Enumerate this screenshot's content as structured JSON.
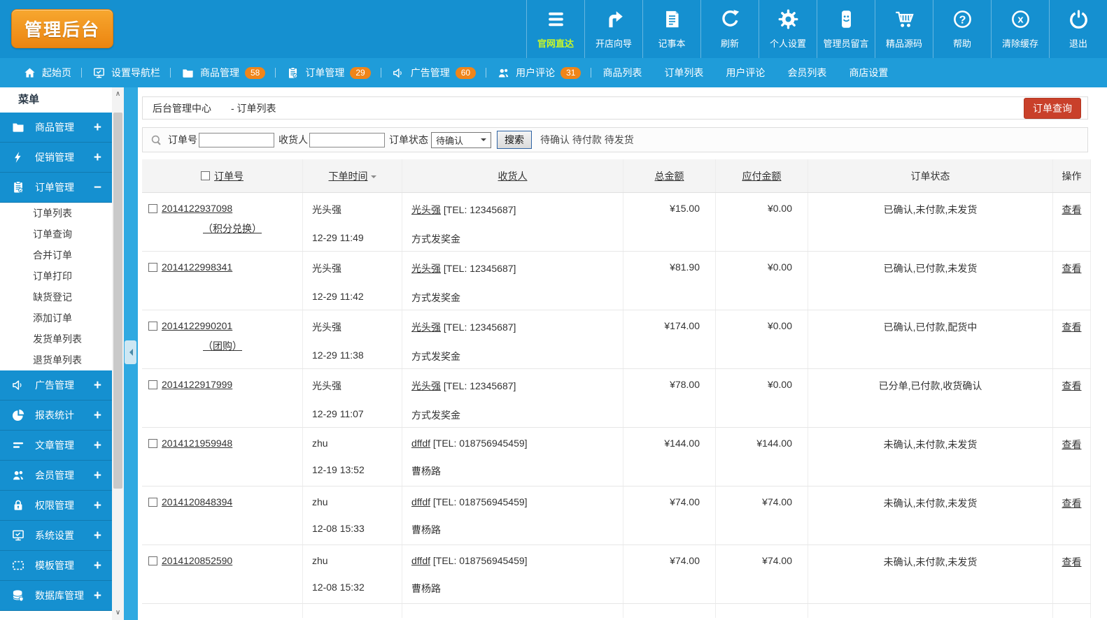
{
  "brand": {
    "title": "管理后台"
  },
  "topbar": {
    "items": [
      {
        "label": "官网直达"
      },
      {
        "label": "开店向导"
      },
      {
        "label": "记事本"
      },
      {
        "label": "刷新"
      },
      {
        "label": "个人设置"
      },
      {
        "label": "管理员留言"
      },
      {
        "label": "精品源码"
      },
      {
        "label": "帮助"
      },
      {
        "label": "清除缓存"
      },
      {
        "label": "退出"
      }
    ]
  },
  "navbar": {
    "items": [
      {
        "label": "起始页"
      },
      {
        "label": "设置导航栏"
      },
      {
        "label": "商品管理",
        "badge": "58"
      },
      {
        "label": "订单管理",
        "badge": "29"
      },
      {
        "label": "广告管理",
        "badge": "60"
      },
      {
        "label": "用户评论",
        "badge": "31"
      }
    ],
    "links": [
      "商品列表",
      "订单列表",
      "用户评论",
      "会员列表",
      "商店设置"
    ]
  },
  "sidebar": {
    "title": "菜单",
    "items": [
      {
        "label": "商品管理",
        "toggle": "+"
      },
      {
        "label": "促销管理",
        "toggle": "+"
      },
      {
        "label": "订单管理",
        "toggle": "−"
      },
      {
        "label": "广告管理",
        "toggle": "+"
      },
      {
        "label": "报表统计",
        "toggle": "+"
      },
      {
        "label": "文章管理",
        "toggle": "+"
      },
      {
        "label": "会员管理",
        "toggle": "+"
      },
      {
        "label": "权限管理",
        "toggle": "+"
      },
      {
        "label": "系统设置",
        "toggle": "+"
      },
      {
        "label": "模板管理",
        "toggle": "+"
      },
      {
        "label": "数据库管理",
        "toggle": "+"
      }
    ],
    "order_submenu": [
      "订单列表",
      "订单查询",
      "合并订单",
      "订单打印",
      "缺货登记",
      "添加订单",
      "发货单列表",
      "退货单列表"
    ]
  },
  "breadcrumb": {
    "root": "后台管理中心",
    "current": "- 订单列表",
    "action_button": "订单查询"
  },
  "search": {
    "order_label": "订单号",
    "consignee_label": "收货人",
    "status_label": "订单状态",
    "status_value": "待确认",
    "submit": "搜索",
    "hint": "待确认 待付款 待发货"
  },
  "table": {
    "headers": {
      "order": "订单号",
      "time": "下单时间",
      "consignee": "收货人",
      "total": "总金额",
      "payable": "应付金额",
      "status": "订单状态",
      "op": "操作"
    },
    "rows": [
      {
        "order_no": "2014122937098",
        "tag": "（积分兑换）",
        "buyer": "光头强",
        "time": "12-29 11:49",
        "consignee": "光头强",
        "tel": "[TEL: 12345687]",
        "line2": "方式发奖金",
        "total": "¥15.00",
        "payable": "¥0.00",
        "status": "已确认,未付款,未发货",
        "op": "查看"
      },
      {
        "order_no": "2014122998341",
        "tag": "",
        "buyer": "光头强",
        "time": "12-29 11:42",
        "consignee": "光头强",
        "tel": "[TEL: 12345687]",
        "line2": "方式发奖金",
        "total": "¥81.90",
        "payable": "¥0.00",
        "status": "已确认,已付款,未发货",
        "op": "查看"
      },
      {
        "order_no": "2014122990201",
        "tag": "（团购）",
        "buyer": "光头强",
        "time": "12-29 11:38",
        "consignee": "光头强",
        "tel": "[TEL: 12345687]",
        "line2": "方式发奖金",
        "total": "¥174.00",
        "payable": "¥0.00",
        "status": "已确认,已付款,配货中",
        "op": "查看"
      },
      {
        "order_no": "2014122917999",
        "tag": "",
        "buyer": "光头强",
        "time": "12-29 11:07",
        "consignee": "光头强",
        "tel": "[TEL: 12345687]",
        "line2": "方式发奖金",
        "total": "¥78.00",
        "payable": "¥0.00",
        "status": "已分单,已付款,收货确认",
        "op": "查看"
      },
      {
        "order_no": "2014121959948",
        "tag": "",
        "buyer": "zhu",
        "time": "12-19 13:52",
        "consignee": "dffdf",
        "tel": "[TEL: 018756945459]",
        "line2": "曹杨路",
        "total": "¥144.00",
        "payable": "¥144.00",
        "status": "未确认,未付款,未发货",
        "op": "查看"
      },
      {
        "order_no": "2014120848394",
        "tag": "",
        "buyer": "zhu",
        "time": "12-08 15:33",
        "consignee": "dffdf",
        "tel": "[TEL: 018756945459]",
        "line2": "曹杨路",
        "total": "¥74.00",
        "payable": "¥74.00",
        "status": "未确认,未付款,未发货",
        "op": "查看"
      },
      {
        "order_no": "2014120852590",
        "tag": "",
        "buyer": "zhu",
        "time": "12-08 15:32",
        "consignee": "dffdf",
        "tel": "[TEL: 018756945459]",
        "line2": "曹杨路",
        "total": "¥74.00",
        "payable": "¥74.00",
        "status": "未确认,未付款,未发货",
        "op": "查看"
      }
    ]
  },
  "colors": {
    "topbar": "#1590d0",
    "navbar": "#1f9cd9",
    "strip": "#2fa9e1",
    "badge_orange": "#f08519",
    "action_red": "#c9402a",
    "highlight_text": "#c8f728"
  }
}
